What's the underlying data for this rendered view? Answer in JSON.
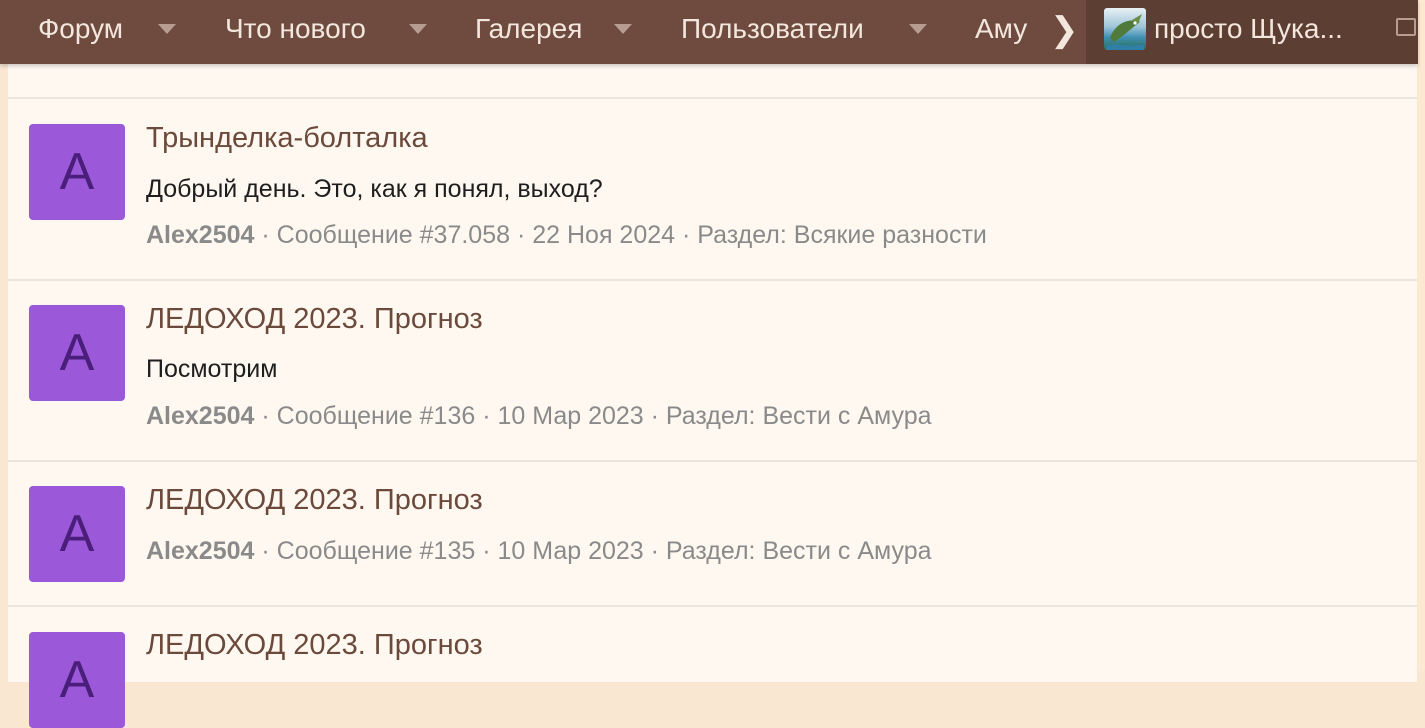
{
  "nav": {
    "items": [
      {
        "label": "Форум"
      },
      {
        "label": "Что нового"
      },
      {
        "label": "Галерея"
      },
      {
        "label": "Пользователи"
      },
      {
        "label": "Аму"
      }
    ],
    "user_name": "просто Щука..."
  },
  "results": [
    {
      "avatar_letter": "A",
      "title": "Трынделка-болталка",
      "snippet": "Добрый день. Это, как я понял, выход?",
      "author": "Alex2504",
      "details": " · Сообщение #37.058 · 22 Ноя 2024 · Раздел: Всякие разности"
    },
    {
      "avatar_letter": "A",
      "title": "ЛЕДОХОД 2023. Прогноз",
      "snippet": "Посмотрим",
      "author": "Alex2504",
      "details": " · Сообщение #136 · 10 Мар 2023 · Раздел: Вести с Амура"
    },
    {
      "avatar_letter": "A",
      "title": "ЛЕДОХОД 2023. Прогноз",
      "snippet": "",
      "author": "Alex2504",
      "details": " · Сообщение #135 · 10 Мар 2023 · Раздел: Вести с Амура"
    },
    {
      "avatar_letter": "A",
      "title": "ЛЕДОХОД 2023. Прогноз",
      "snippet": "",
      "author": "",
      "details": ""
    }
  ],
  "colors": {
    "nav_bg": "#6e4b3e",
    "avatar_bg": "#9b59d9",
    "title_color": "#6b4a3c",
    "page_bg": "#fef8f1"
  }
}
